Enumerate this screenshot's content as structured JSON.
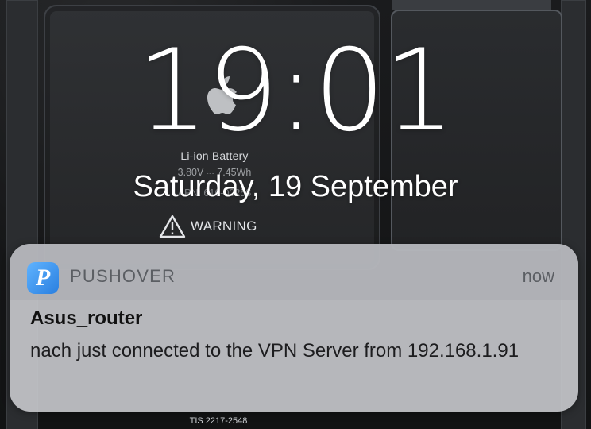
{
  "wallpaper": {
    "battery_label": "Li-ion Battery",
    "battery_spec": "3.80V ⎓ 7.45Wh",
    "battery_spec2": "APN: 616-00258",
    "warning_label": "WARNING",
    "footer_text": "TIS 2217-2548"
  },
  "lockscreen": {
    "time": "19:01",
    "date": "Saturday, 19 September"
  },
  "notification": {
    "app_name": "PUSHOVER",
    "app_icon_letter": "P",
    "time": "now",
    "title": "Asus_router",
    "body": "nach just connected to the VPN Server from 192.168.1.91"
  },
  "colors": {
    "notification_bg": "#c4c6ca",
    "app_icon": "#3a8ef0",
    "clock_text": "#ffffff"
  },
  "icons": {
    "app_icon": "pushover-icon",
    "warning": "warning-triangle-icon",
    "logo": "apple-logo-icon"
  }
}
